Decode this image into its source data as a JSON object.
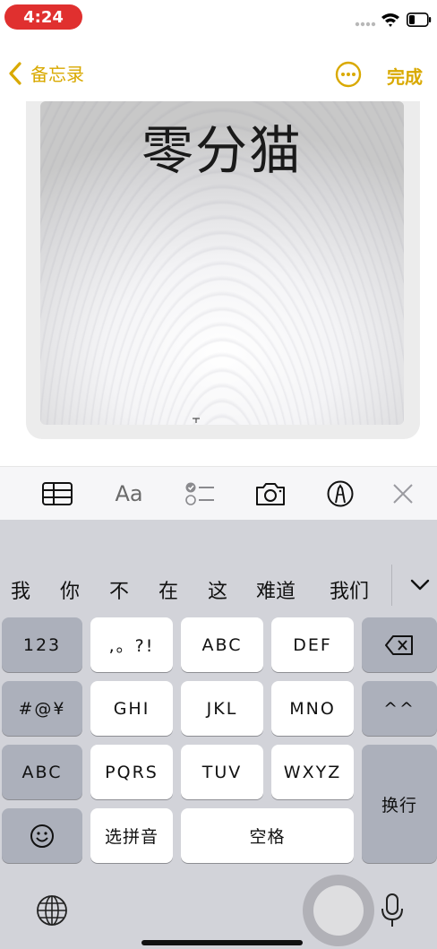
{
  "status_bar": {
    "time": "4:24",
    "icons": [
      "signal-dots-icon",
      "wifi-icon",
      "battery-icon"
    ],
    "time_color": "#e0302f"
  },
  "nav": {
    "back_label": "备忘录",
    "done_label": "完成",
    "accent_color": "#d9a900",
    "more_icon": "ellipsis-circle-icon"
  },
  "note": {
    "image_text": "零分猫"
  },
  "toolbar": {
    "items": [
      "table-icon",
      "text-format-icon",
      "checklist-icon",
      "camera-icon",
      "markup-icon",
      "close-icon"
    ],
    "text_format_label": "Aa"
  },
  "keyboard": {
    "candidates": [
      "我",
      "你",
      "不",
      "在",
      "这",
      "难道",
      "我们"
    ],
    "row1": {
      "k1": "123",
      "k2": ",。?!",
      "k3": "ABC",
      "k4": "DEF"
    },
    "row2": {
      "k1": "#@¥",
      "k2": "GHI",
      "k3": "JKL",
      "k4": "MNO",
      "k5": "^^"
    },
    "row3": {
      "k1": "ABC",
      "k2": "PQRS",
      "k3": "TUV",
      "k4": "WXYZ",
      "return": "换行"
    },
    "row4": {
      "k2": "选拼音",
      "space": "空格"
    },
    "icons": [
      "delete-icon",
      "emoji-icon",
      "globe-icon",
      "microphone-icon",
      "chevron-down-icon"
    ]
  }
}
